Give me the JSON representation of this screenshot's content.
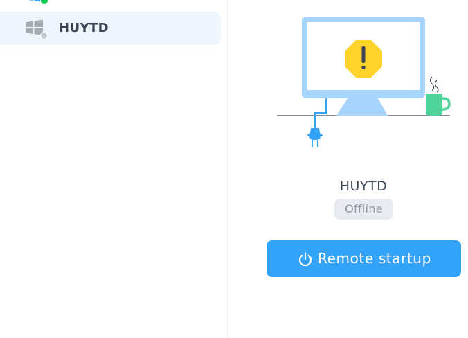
{
  "sidebar": {
    "items": [
      {
        "label": "",
        "status": "online",
        "status_color": "#00c853",
        "icon": "windows-icon"
      },
      {
        "label": "HUYTD",
        "status": "offline",
        "status_color": "#c4c9d0",
        "icon": "windows-icon"
      }
    ]
  },
  "main": {
    "host_name": "HUYTD",
    "status": "Offline",
    "button_label": "Remote startup",
    "illustration_icons": [
      "monitor-icon",
      "warning-icon",
      "coffee-mug-icon",
      "power-plug-icon"
    ]
  },
  "colors": {
    "accent": "#34a4fa",
    "monitor": "#a6d4fc",
    "warning": "#fdd32c",
    "mug": "#4fd39b",
    "selected_bg": "#eef5fd",
    "badge_bg": "#e8ebef"
  }
}
